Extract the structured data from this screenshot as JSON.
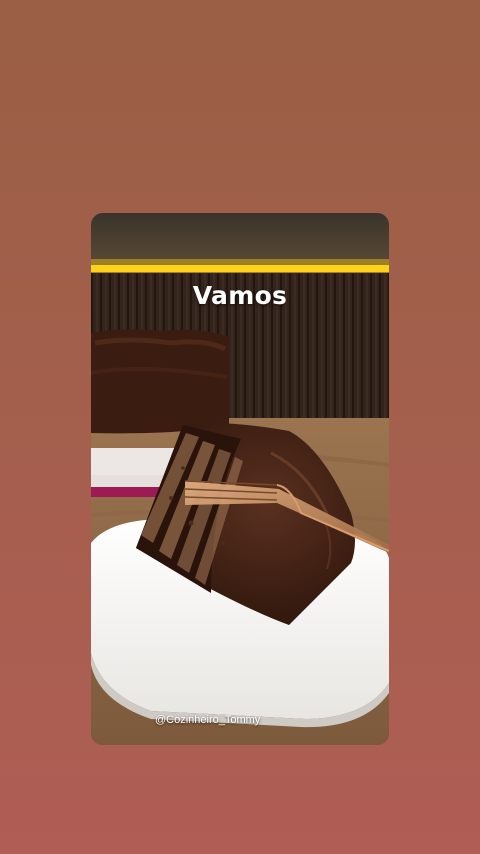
{
  "story": {
    "caption": "Vamos",
    "watermark": "@Cozinheiro_Tommy",
    "media_subject": "chocolate-cake-slice-photo"
  },
  "colors": {
    "background_top": "#9a5f44",
    "background_bottom": "#b05d55",
    "led_strip": "#ffd21a",
    "chocolate": "#3a1d10",
    "plate": "#f4f3f0",
    "fork": "#c08a5e"
  }
}
